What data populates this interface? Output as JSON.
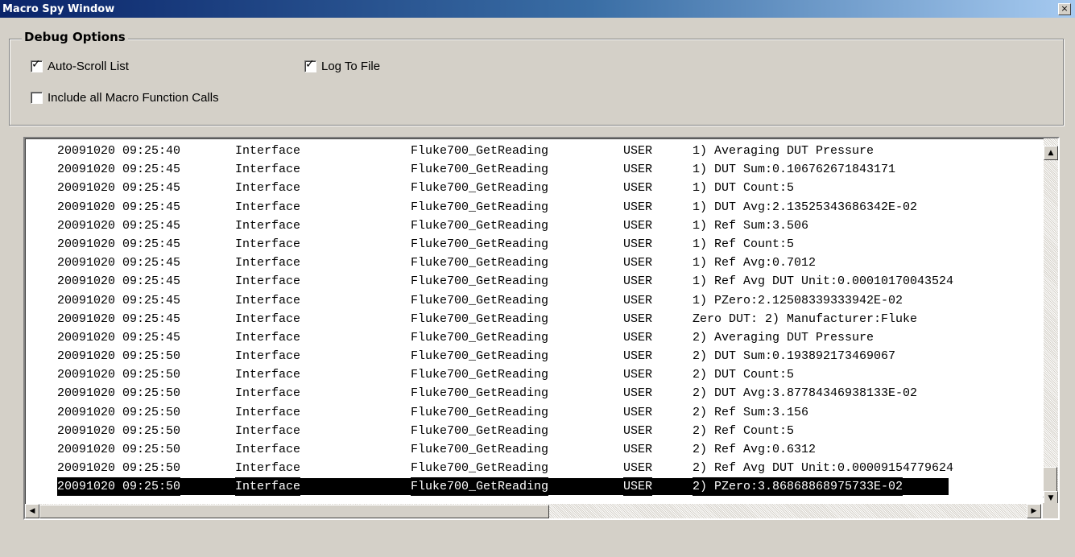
{
  "window": {
    "title": "Macro Spy Window",
    "close_label": "×"
  },
  "debug_options": {
    "legend": "Debug Options",
    "auto_scroll": {
      "label": "Auto-Scroll List",
      "checked": true
    },
    "log_to_file": {
      "label": "Log To File",
      "checked": true
    },
    "include_all": {
      "label": "Include all Macro Function Calls",
      "checked": false
    }
  },
  "log": {
    "selected_index": 18,
    "rows": [
      {
        "timestamp": "20091020 09:25:40",
        "category": "Interface",
        "function": "Fluke700_GetReading",
        "source": "USER",
        "message": "1) Averaging DUT Pressure"
      },
      {
        "timestamp": "20091020 09:25:45",
        "category": "Interface",
        "function": "Fluke700_GetReading",
        "source": "USER",
        "message": "1) DUT Sum:0.106762671843171"
      },
      {
        "timestamp": "20091020 09:25:45",
        "category": "Interface",
        "function": "Fluke700_GetReading",
        "source": "USER",
        "message": "1) DUT Count:5"
      },
      {
        "timestamp": "20091020 09:25:45",
        "category": "Interface",
        "function": "Fluke700_GetReading",
        "source": "USER",
        "message": "1) DUT Avg:2.13525343686342E-02"
      },
      {
        "timestamp": "20091020 09:25:45",
        "category": "Interface",
        "function": "Fluke700_GetReading",
        "source": "USER",
        "message": "1) Ref Sum:3.506"
      },
      {
        "timestamp": "20091020 09:25:45",
        "category": "Interface",
        "function": "Fluke700_GetReading",
        "source": "USER",
        "message": "1) Ref Count:5"
      },
      {
        "timestamp": "20091020 09:25:45",
        "category": "Interface",
        "function": "Fluke700_GetReading",
        "source": "USER",
        "message": "1) Ref Avg:0.7012"
      },
      {
        "timestamp": "20091020 09:25:45",
        "category": "Interface",
        "function": "Fluke700_GetReading",
        "source": "USER",
        "message": "1) Ref Avg DUT Unit:0.00010170043524"
      },
      {
        "timestamp": "20091020 09:25:45",
        "category": "Interface",
        "function": "Fluke700_GetReading",
        "source": "USER",
        "message": "1) PZero:2.12508339333942E-02"
      },
      {
        "timestamp": "20091020 09:25:45",
        "category": "Interface",
        "function": "Fluke700_GetReading",
        "source": "USER",
        "message": "Zero DUT: 2) Manufacturer:Fluke"
      },
      {
        "timestamp": "20091020 09:25:45",
        "category": "Interface",
        "function": "Fluke700_GetReading",
        "source": "USER",
        "message": "2) Averaging DUT Pressure"
      },
      {
        "timestamp": "20091020 09:25:50",
        "category": "Interface",
        "function": "Fluke700_GetReading",
        "source": "USER",
        "message": "2) DUT Sum:0.193892173469067"
      },
      {
        "timestamp": "20091020 09:25:50",
        "category": "Interface",
        "function": "Fluke700_GetReading",
        "source": "USER",
        "message": "2) DUT Count:5"
      },
      {
        "timestamp": "20091020 09:25:50",
        "category": "Interface",
        "function": "Fluke700_GetReading",
        "source": "USER",
        "message": "2) DUT Avg:3.87784346938133E-02"
      },
      {
        "timestamp": "20091020 09:25:50",
        "category": "Interface",
        "function": "Fluke700_GetReading",
        "source": "USER",
        "message": "2) Ref Sum:3.156"
      },
      {
        "timestamp": "20091020 09:25:50",
        "category": "Interface",
        "function": "Fluke700_GetReading",
        "source": "USER",
        "message": "2) Ref Count:5"
      },
      {
        "timestamp": "20091020 09:25:50",
        "category": "Interface",
        "function": "Fluke700_GetReading",
        "source": "USER",
        "message": "2) Ref Avg:0.6312"
      },
      {
        "timestamp": "20091020 09:25:50",
        "category": "Interface",
        "function": "Fluke700_GetReading",
        "source": "USER",
        "message": "2) Ref Avg DUT Unit:0.00009154779624"
      },
      {
        "timestamp": "20091020 09:25:50",
        "category": "Interface",
        "function": "Fluke700_GetReading",
        "source": "USER",
        "message": "2) PZero:3.86868868975733E-02"
      }
    ]
  },
  "scrollbars": {
    "up_arrow": "▲",
    "down_arrow": "▼",
    "left_arrow": "◀",
    "right_arrow": "▶"
  }
}
